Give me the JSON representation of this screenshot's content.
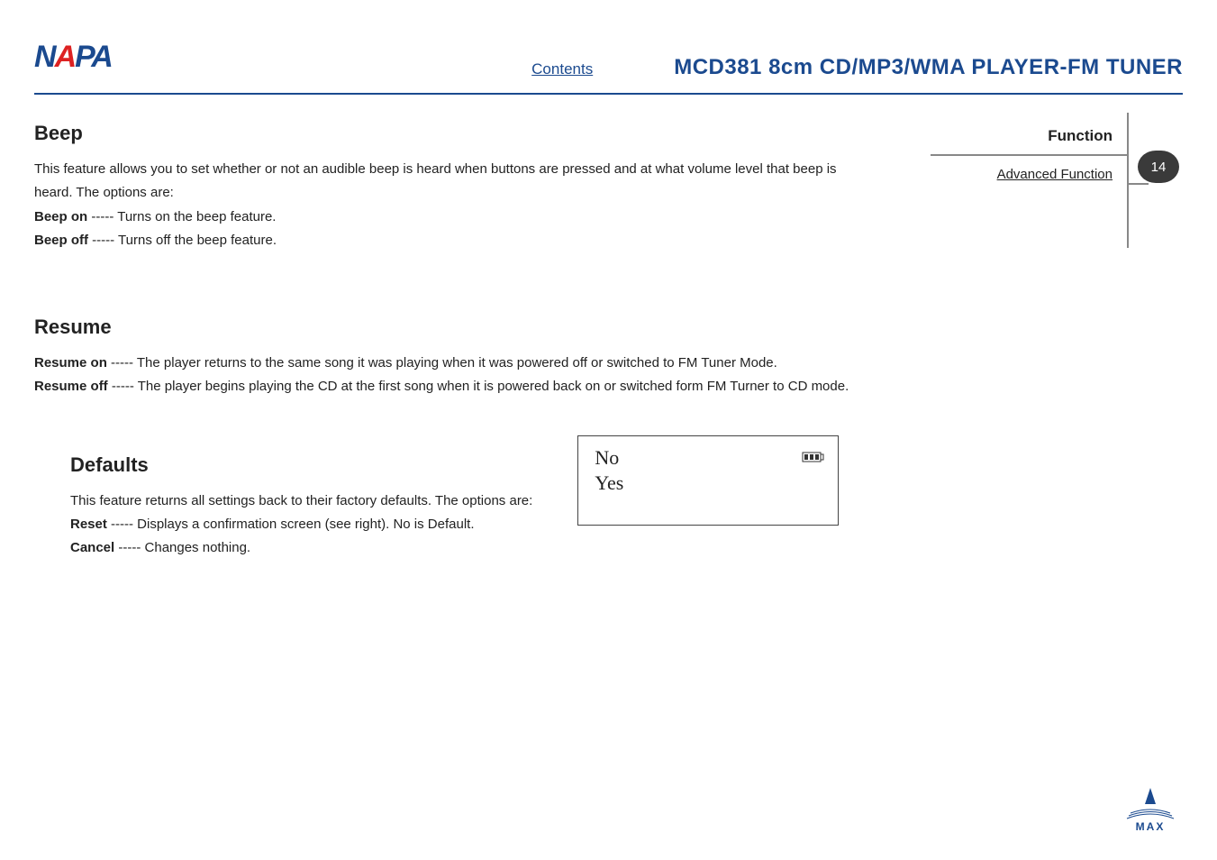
{
  "header": {
    "logo_text_1": "N",
    "logo_text_2": "A",
    "logo_text_3": "PA",
    "contents_link": "Contents",
    "title": "MCD381  8cm  CD/MP3/WMA  PLAYER-FM  TUNER"
  },
  "side": {
    "function_label": "Function",
    "advanced_link": "Advanced  Function",
    "page_number": "14"
  },
  "beep": {
    "heading": "Beep",
    "intro": "This feature allows you to set whether or not an audible beep is heard when buttons are pressed and at what volume level that beep is heard. The options are:",
    "opt1_label": "Beep on",
    "opt1_desc": " ----- Turns on the beep feature.",
    "opt2_label": "Beep off",
    "opt2_desc": " ----- Turns off the beep feature."
  },
  "resume": {
    "heading": "Resume",
    "opt1_label": "Resume on",
    "opt1_desc": " ----- The player returns to the same song it was playing when it was powered off or switched to FM Tuner Mode.",
    "opt2_label": "Resume off",
    "opt2_desc": " ----- The player begins playing the CD at the first song when it is powered back on or switched form FM Turner   to CD mode."
  },
  "defaults": {
    "heading": "Defaults",
    "intro": "This feature returns all settings back to their factory defaults. The options are:",
    "opt1_label": "Reset",
    "opt1_desc": " ----- Displays a confirmation screen (see right). No is Default.",
    "opt2_label": "Cancel",
    "opt2_desc": " ----- Changes nothing.",
    "lcd_option_no": "No",
    "lcd_option_yes": "Yes"
  },
  "footer": {
    "max_label": "MAX"
  }
}
